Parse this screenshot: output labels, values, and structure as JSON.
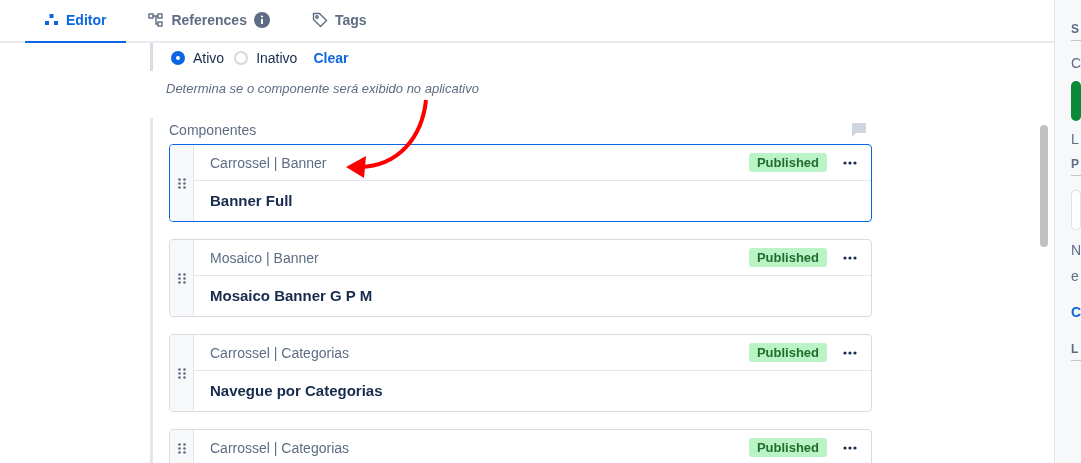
{
  "tabs": [
    {
      "label": "Editor",
      "kind": "blocks",
      "selected": true,
      "info": false
    },
    {
      "label": "References",
      "kind": "tree",
      "selected": false,
      "info": true
    },
    {
      "label": "Tags",
      "kind": "tag",
      "selected": false,
      "info": false
    }
  ],
  "status_field": {
    "options": [
      {
        "label": "Ativo",
        "selected": true
      },
      {
        "label": "Inativo",
        "selected": false
      }
    ],
    "clear": "Clear",
    "hint": "Determina se o componente será exibido no aplicativo"
  },
  "components": {
    "label": "Componentes",
    "items": [
      {
        "type": "Carrossel | Banner",
        "status": "Published",
        "title": "Banner Full",
        "selected": true
      },
      {
        "type": "Mosaico | Banner",
        "status": "Published",
        "title": "Mosaico Banner G P M",
        "selected": false
      },
      {
        "type": "Carrossel | Categorias",
        "status": "Published",
        "title": "Navegue por Categorias",
        "selected": false
      },
      {
        "type": "Carrossel | Categorias",
        "status": "Published",
        "selected": false
      }
    ]
  },
  "side_panel": [
    {
      "kind": "heading",
      "text": "S"
    },
    {
      "kind": "text",
      "text": "C"
    },
    {
      "kind": "green-button"
    },
    {
      "kind": "text",
      "text": "L"
    },
    {
      "kind": "heading",
      "text": "P"
    },
    {
      "kind": "input"
    },
    {
      "kind": "text",
      "text": "N"
    },
    {
      "kind": "text",
      "text": "e"
    },
    {
      "kind": "link",
      "text": "C"
    },
    {
      "kind": "heading",
      "text": "L"
    }
  ]
}
